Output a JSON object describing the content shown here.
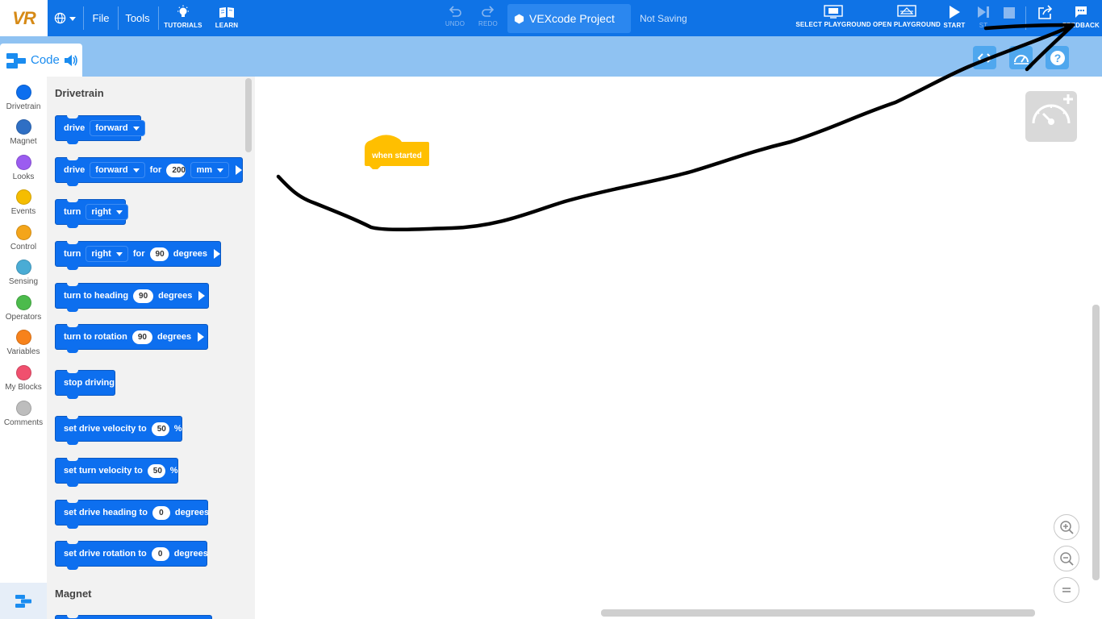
{
  "topbar": {
    "logo_text": "VR",
    "file_label": "File",
    "tools_label": "Tools",
    "tutorials_label": "TUTORIALS",
    "learn_label": "LEARN",
    "undo_label": "UNDO",
    "redo_label": "REDO",
    "project_name": "VEXcode Project",
    "save_status": "Not Saving",
    "select_playground_label": "SELECT PLAYGROUND",
    "open_playground_label": "OPEN PLAYGROUND",
    "start_label": "START",
    "step_label": "ST",
    "feedback_label": "FEEDBACK"
  },
  "subbar": {
    "code_tab_label": "Code"
  },
  "categories": [
    {
      "label": "Drivetrain",
      "color": "#0d6fef"
    },
    {
      "label": "Magnet",
      "color": "#2f6fc4"
    },
    {
      "label": "Looks",
      "color": "#9b5cf0"
    },
    {
      "label": "Events",
      "color": "#f5bd00"
    },
    {
      "label": "Control",
      "color": "#f4a51a"
    },
    {
      "label": "Sensing",
      "color": "#4aacd5"
    },
    {
      "label": "Operators",
      "color": "#4cbb4c"
    },
    {
      "label": "Variables",
      "color": "#f7821b"
    },
    {
      "label": "My Blocks",
      "color": "#f0506e"
    },
    {
      "label": "Comments",
      "color": "#bdbdbd"
    }
  ],
  "flyout": {
    "drivetrain_heading": "Drivetrain",
    "magnet_heading": "Magnet",
    "blocks": {
      "b1": {
        "t1": "drive",
        "dd1": "forward"
      },
      "b2": {
        "t1": "drive",
        "dd1": "forward",
        "t2": "for",
        "num": "200",
        "dd2": "mm"
      },
      "b3": {
        "t1": "turn",
        "dd1": "right"
      },
      "b4": {
        "t1": "turn",
        "dd1": "right",
        "t2": "for",
        "num": "90",
        "t3": "degrees"
      },
      "b5": {
        "t1": "turn to heading",
        "num": "90",
        "t2": "degrees"
      },
      "b6": {
        "t1": "turn to rotation",
        "num": "90",
        "t2": "degrees"
      },
      "b7": {
        "t1": "stop driving"
      },
      "b8": {
        "t1": "set drive velocity to",
        "num": "50",
        "t2": "%"
      },
      "b9": {
        "t1": "set turn velocity to",
        "num": "50",
        "t2": "%"
      },
      "b10": {
        "t1": "set drive heading to",
        "num": "0",
        "t2": "degrees"
      },
      "b11": {
        "t1": "set drive rotation to",
        "num": "0",
        "t2": "degrees"
      }
    }
  },
  "workspace": {
    "hat_block_label": "when started",
    "hat_color": "#ffbf00"
  },
  "colors": {
    "topbar": "#0f73e6",
    "subbar": "#8fc2f2",
    "drivetrain_block": "#0d6fef",
    "logo": "#d68a16"
  }
}
